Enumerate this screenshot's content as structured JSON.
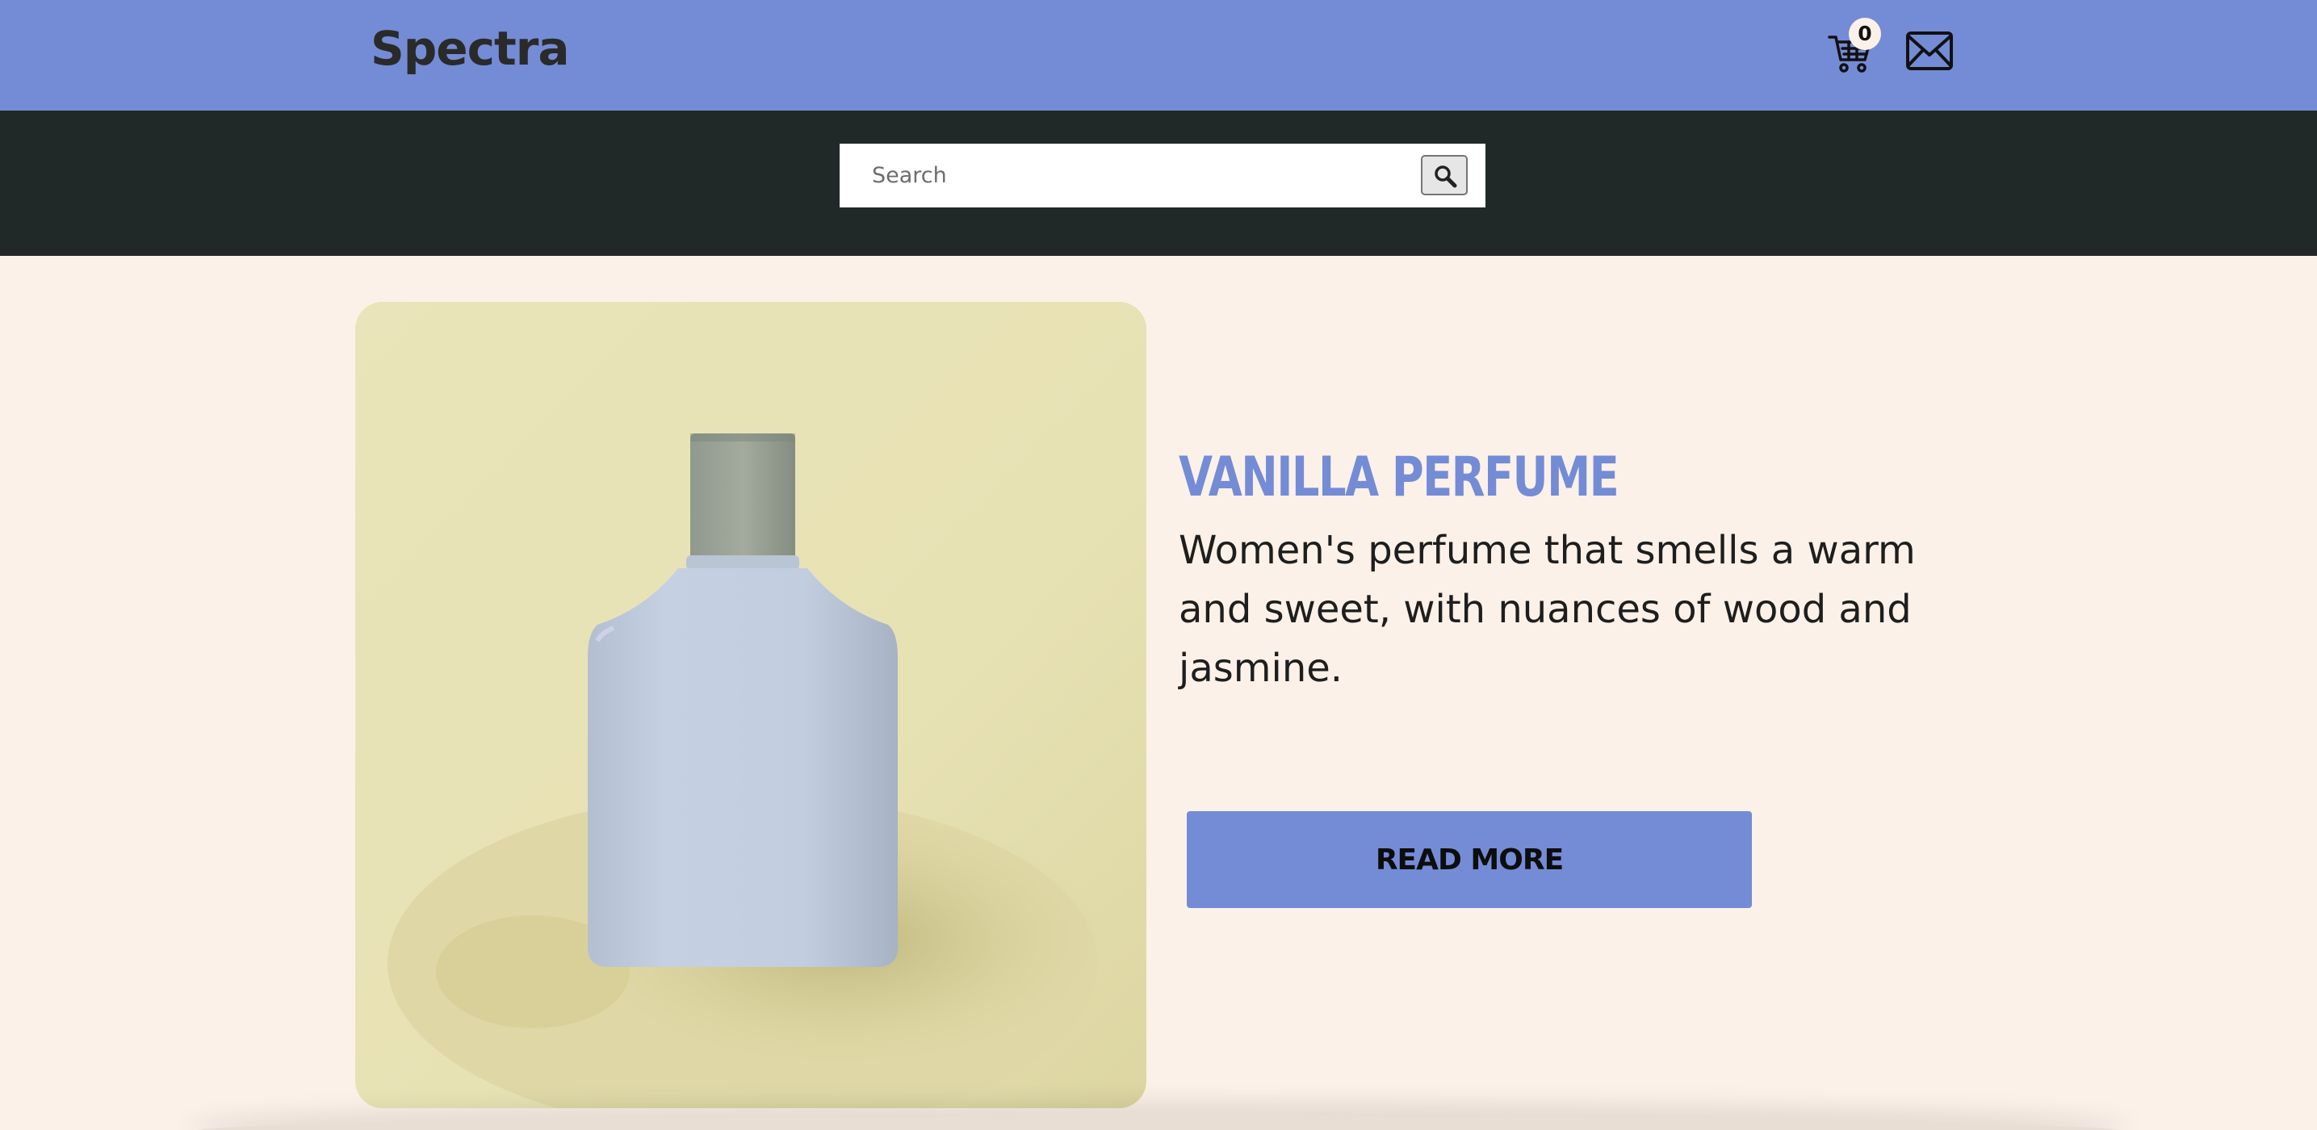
{
  "header": {
    "logo": "Spectra",
    "cart_count": "0",
    "cart_icon": "cart-icon",
    "mail_icon": "mail-icon"
  },
  "search": {
    "placeholder": "Search",
    "button_icon": "search-icon"
  },
  "product": {
    "image": "perfume-bottle-photo",
    "title": "VANILLA PERFUME",
    "description": "Women's perfume that smells a warm and sweet, with nuances of wood and jasmine.",
    "cta_label": "READ MORE"
  },
  "colors": {
    "accent": "#748cd6",
    "dark": "#212828",
    "background": "#fcf1e8"
  }
}
